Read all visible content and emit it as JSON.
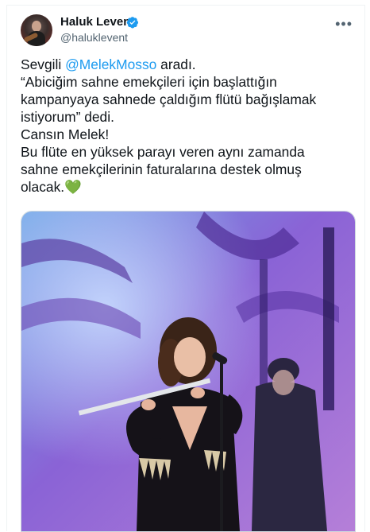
{
  "author": {
    "name": "Haluk Levent",
    "handle": "@haluklevent",
    "verified": true,
    "avatar_icon": "user-avatar"
  },
  "menu": {
    "icon": "more-icon",
    "glyph": "•••"
  },
  "tweet": {
    "line1_prefix": "Sevgili ",
    "line1_mention": "@MelekMosso",
    "line1_suffix": " aradı.",
    "line2": "“Abiciğim sahne emekçileri için başlattığın",
    "line3": "kampanyaya sahnede çaldığım flütü bağışlamak",
    "line4": "istiyorum” dedi.",
    "line5": "Cansın Melek!",
    "line6": "Bu flüte en yüksek parayı veren aynı zamanda",
    "line7": "sahne emekçilerinin faturalarına destek olmuş",
    "line8": "olacak.",
    "emoji": "💚"
  },
  "colors": {
    "accent": "#1d9bf0",
    "text": "#0f1419",
    "secondary": "#536471",
    "heart": "#5fbf3b"
  },
  "media": {
    "icon": "photo-image",
    "description_visible": false
  }
}
